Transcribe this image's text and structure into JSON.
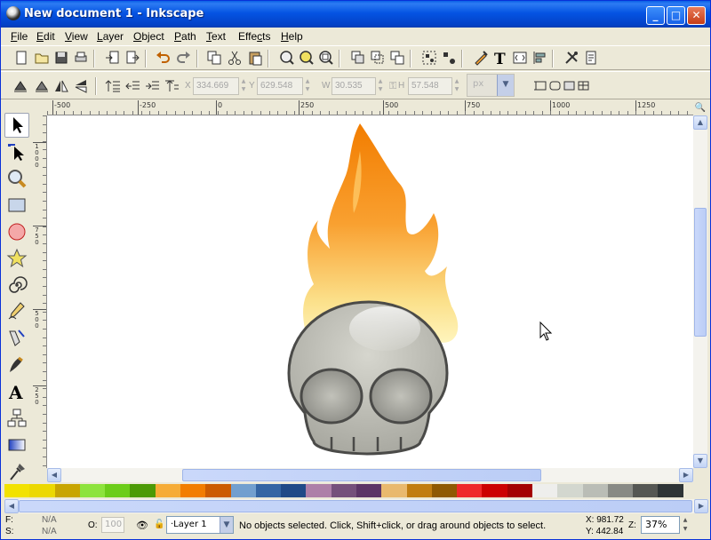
{
  "window": {
    "title": "New document 1 - Inkscape",
    "minimize": "_",
    "maximize": "□",
    "close": "✕"
  },
  "menu": [
    {
      "label": "File",
      "accel": "F",
      "rest": "ile"
    },
    {
      "label": "Edit",
      "accel": "E",
      "rest": "dit"
    },
    {
      "label": "View",
      "accel": "V",
      "rest": "iew"
    },
    {
      "label": "Layer",
      "accel": "L",
      "rest": "ayer"
    },
    {
      "label": "Object",
      "accel": "O",
      "rest": "bject"
    },
    {
      "label": "Path",
      "accel": "P",
      "rest": "ath"
    },
    {
      "label": "Text",
      "accel": "T",
      "rest": "ext"
    },
    {
      "label": "Effects",
      "accel": "c",
      "rest": "Effe|ts"
    },
    {
      "label": "Help",
      "accel": "H",
      "rest": "elp"
    }
  ],
  "toolbar1_icons": [
    "new-icon",
    "open-icon",
    "save-icon",
    "print-icon",
    "import-icon",
    "export-icon",
    "undo-icon",
    "redo-icon",
    "copy-icon",
    "cut-icon",
    "paste-icon",
    "zoom-selection-icon",
    "zoom-drawing-icon",
    "zoom-page-icon",
    "duplicate-icon",
    "clone-icon",
    "unlink-clone-icon",
    "group-icon",
    "ungroup-icon",
    "fill-stroke-icon",
    "text-font-icon",
    "xml-editor-icon",
    "align-icon",
    "preferences-icon",
    "document-properties-icon"
  ],
  "toolbar2": {
    "x_label": "X",
    "x_value": "334.669",
    "y_label": "Y",
    "y_value": "629.548",
    "w_label": "W",
    "w_value": "30.535",
    "h_label": "H",
    "h_value": "57.548",
    "units": "px",
    "lock_symbol": "⚿"
  },
  "hruler": {
    "labels": [
      "-500",
      "-250",
      "0",
      "250",
      "500",
      "750",
      "1000",
      "1250"
    ]
  },
  "vruler": {
    "labels": [
      "1000",
      "750",
      "500",
      "250"
    ]
  },
  "palette": [
    "#f2e200",
    "#ecd800",
    "#c8a500",
    "#8de33c",
    "#6ccd19",
    "#4c9a06",
    "#f6ac37",
    "#f27d00",
    "#cc5c00",
    "#729fcf",
    "#3465a4",
    "#204a87",
    "#ad7fa8",
    "#75507b",
    "#5c3566",
    "#e9b96e",
    "#c17d11",
    "#8f5902",
    "#ef2929",
    "#cc0000",
    "#a40000",
    "#eeeeec",
    "#d3d7cf",
    "#babdb6",
    "#888a85",
    "#555753",
    "#2e3436"
  ],
  "status": {
    "fill_label": "F:",
    "fill_value": "N/A",
    "stroke_label": "S:",
    "stroke_value": "N/A",
    "opacity_label": "O:",
    "opacity_value": "100",
    "layer": "·Layer 1",
    "message": "No objects selected. Click, Shift+click, or drag around objects to select.",
    "cursor_x": "X: 981.72",
    "cursor_y": "Y: 442.84",
    "zoom_label": "Z:",
    "zoom": "37%"
  },
  "colors": {
    "flame_top": "#f27d00",
    "flame_bottom": "#fff3a0",
    "skull": "#b8b8b0",
    "skull_outline": "#4a4a48"
  }
}
